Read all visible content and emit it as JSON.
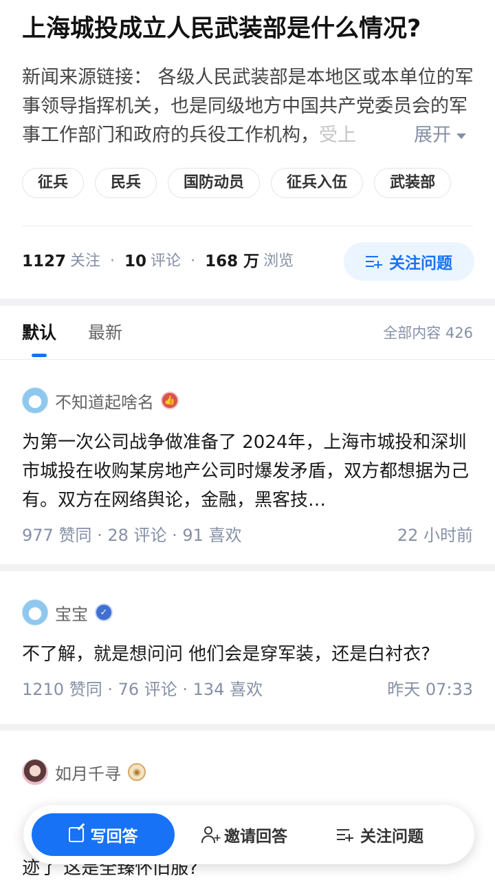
{
  "question": {
    "title": "上海城投成立人民武装部是什么情况?",
    "description_main": "新闻来源链接： 各级人民武装部是本地区或本单位的军事领导指挥机关，也是同级地方中国共产党委员会的军事工作部门和政府的兵役工作机构，",
    "description_fade": "受上",
    "expand_label": "展开",
    "tags": [
      "征兵",
      "民兵",
      "国防动员",
      "征兵入伍",
      "武装部"
    ],
    "stats": {
      "follow_count": "1127",
      "follow_label": "关注",
      "comment_count": "10",
      "comment_label": "评论",
      "view_count": "168 万",
      "view_label": "浏览"
    },
    "follow_button": "关注问题"
  },
  "tabs": {
    "default": "默认",
    "latest": "最新",
    "total": "全部内容 426"
  },
  "answers": [
    {
      "author": "不知道起啥名",
      "content": "为第一次公司战争做准备了 2024年，上海市城投和深圳市城投在收购某房地产公司时爆发矛盾，双方都想据为己有。双方在网络舆论，金融，黑客技…",
      "meta": "977 赞同 · 28 评论 · 91 喜欢",
      "time": "22 小时前"
    },
    {
      "author": "宝宝",
      "content": "不了解，就是想问问 他们会是穿军装，还是白衬衣?",
      "meta": "1210 赞同 · 76 评论 · 134 喜欢",
      "time": "昨天 07:33"
    },
    {
      "author": "如月千寻",
      "peek": "迹了 这是全臻怀旧服?"
    }
  ],
  "bottom_bar": {
    "write": "写回答",
    "invite": "邀请回答",
    "follow": "关注问题"
  },
  "colors": {
    "accent": "#1772f6",
    "accent_light": "#ebf5ff",
    "meta_gray": "#8590a6"
  },
  "icons": [
    "plus-list-icon",
    "pencil-icon",
    "person-add-icon",
    "expand-caret-icon"
  ]
}
